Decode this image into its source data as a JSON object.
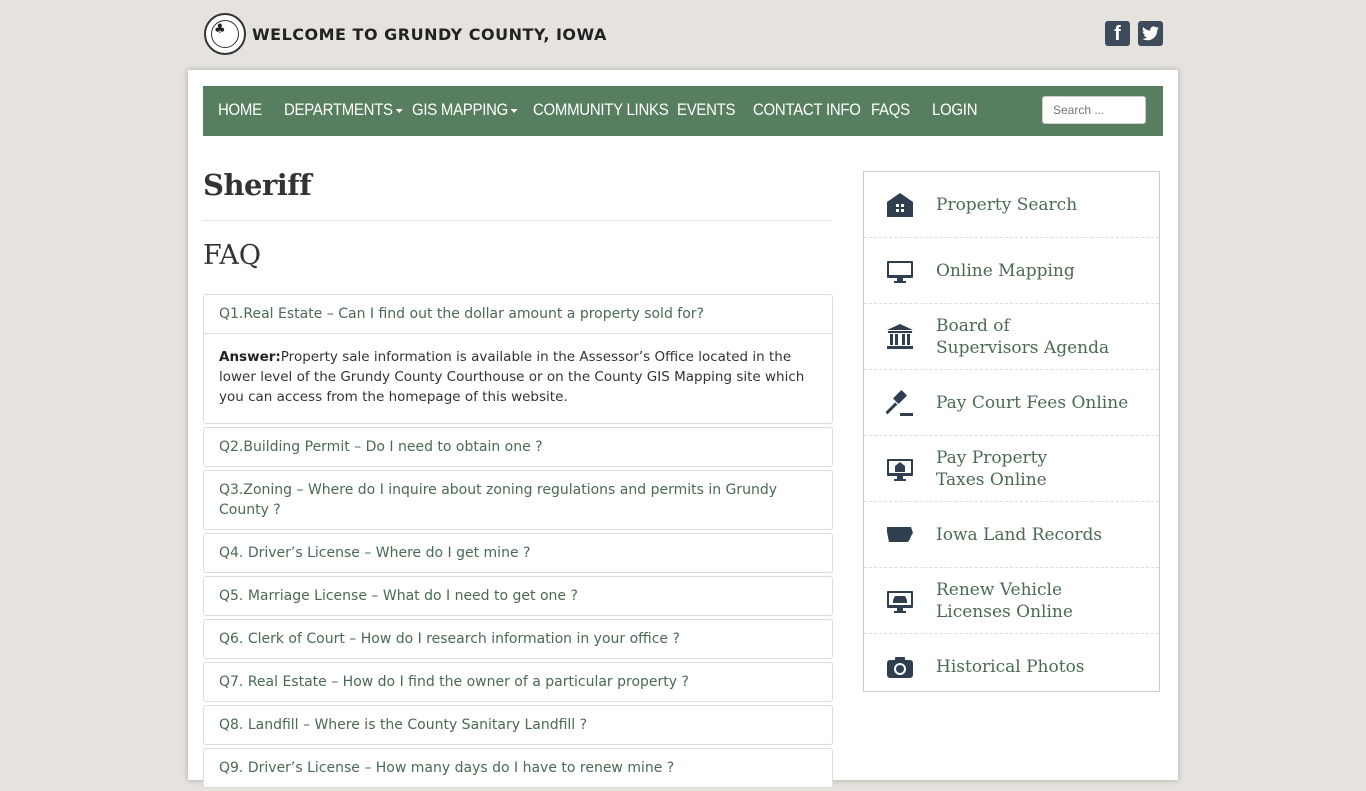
{
  "header": {
    "site_title": "WELCOME TO GRUNDY COUNTY, IOWA",
    "social": [
      {
        "icon": "facebook-icon",
        "glyph": "f"
      },
      {
        "icon": "twitter-icon",
        "glyph": "t"
      }
    ]
  },
  "nav": {
    "items": [
      {
        "label": "HOME",
        "dropdown": false
      },
      {
        "label": "DEPARTMENTS",
        "dropdown": true
      },
      {
        "label": "GIS MAPPING",
        "dropdown": true
      },
      {
        "label": "COMMUNITY LINKS",
        "dropdown": false
      },
      {
        "label": "EVENTS",
        "dropdown": false
      },
      {
        "label": "CONTACT INFO",
        "dropdown": false
      },
      {
        "label": "FAQS",
        "dropdown": false
      },
      {
        "label": "LOGIN",
        "dropdown": false
      }
    ],
    "search_placeholder": "Search ..."
  },
  "main": {
    "page_title": "Sheriff",
    "faq_heading": "FAQ",
    "faqs": [
      {
        "question": "Q1.Real Estate – Can I find out the dollar amount a property sold for?",
        "answer_label": "Answer:",
        "answer_text": "Property sale information is available in the Assessor’s Office located in the lower level of the Grundy County Courthouse or on the County GIS Mapping site which you can access from the homepage of this website."
      },
      {
        "question": "Q2.Building Permit – Do I need to obtain one ?"
      },
      {
        "question": "Q3.Zoning – Where do I inquire about zoning regulations and permits in Grundy County ?"
      },
      {
        "question": "Q4. Driver’s License – Where do I get mine ?"
      },
      {
        "question": "Q5. Marriage License – What do I need to get one ?"
      },
      {
        "question": "Q6. Clerk of Court – How do I research information in your office ?"
      },
      {
        "question": "Q7. Real Estate – How do I find the owner of a particular property ?"
      },
      {
        "question": "Q8. Landfill – Where is the County Sanitary Landfill ?"
      },
      {
        "question": "Q9. Driver’s License – How many days do I have to renew mine ?"
      }
    ]
  },
  "sidebar": {
    "items": [
      {
        "label": "Property Search",
        "icon": "house-icon"
      },
      {
        "label": "Online Mapping",
        "icon": "monitor-icon"
      },
      {
        "label": "Board of\nSupervisors Agenda",
        "icon": "courthouse-icon"
      },
      {
        "label": "Pay Court Fees Online",
        "icon": "gavel-icon"
      },
      {
        "label": "Pay Property\nTaxes Online",
        "icon": "monitor-house-icon"
      },
      {
        "label": "Iowa Land Records",
        "icon": "iowa-map-icon"
      },
      {
        "label": "Renew Vehicle\nLicenses Online",
        "icon": "monitor-car-icon"
      },
      {
        "label": "Historical Photos",
        "icon": "camera-icon"
      }
    ]
  },
  "colors": {
    "nav_bg": "#577e5f",
    "link_green": "#4a6a52",
    "icon_dark": "#2f3f4f",
    "page_bg": "#e6e3de"
  }
}
